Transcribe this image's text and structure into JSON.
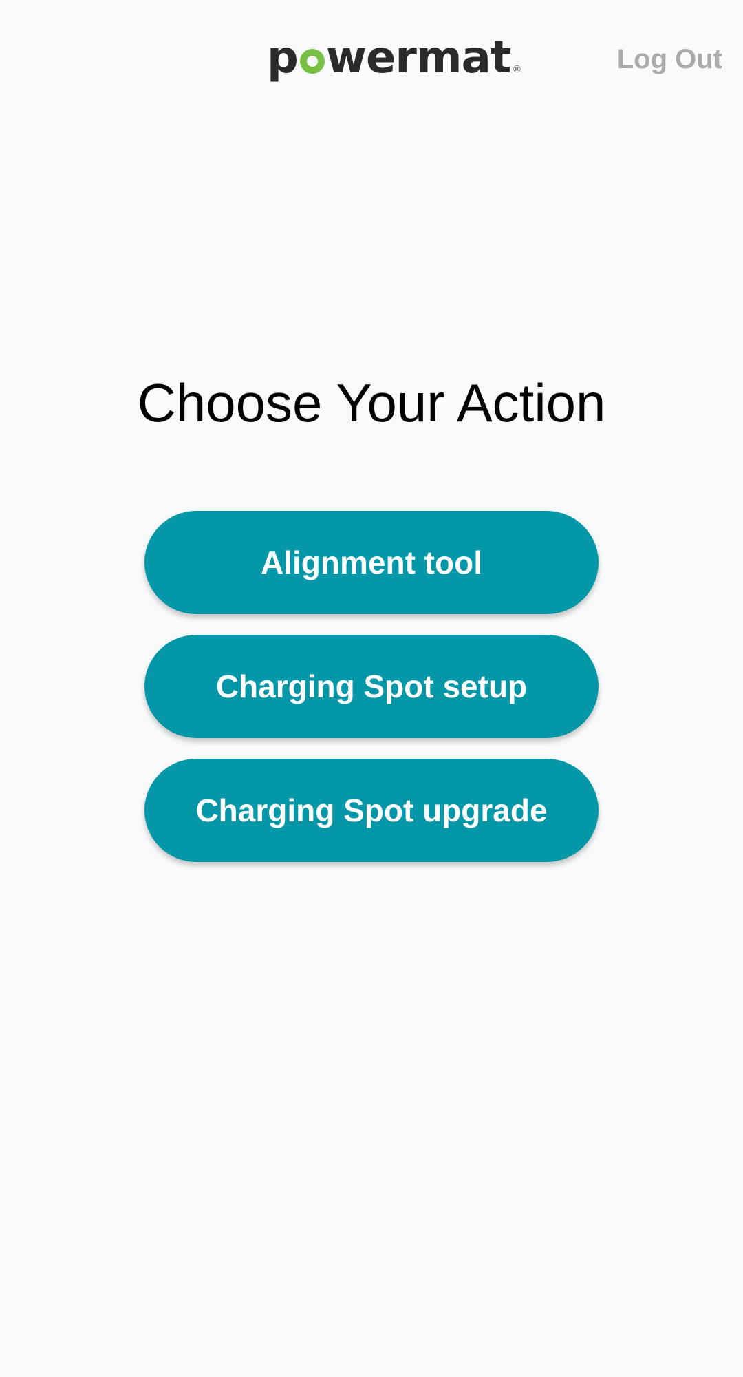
{
  "header": {
    "logo_prefix": "p",
    "logo_suffix": "wermat",
    "logo_reg": "®",
    "logout_label": "Log Out"
  },
  "main": {
    "title": "Choose Your Action",
    "actions": [
      {
        "label": "Alignment tool"
      },
      {
        "label": "Charging Spot setup"
      },
      {
        "label": "Charging Spot upgrade"
      }
    ]
  },
  "colors": {
    "accent": "#0497a7",
    "logo_green": "#78c043",
    "logout_gray": "#a9abad",
    "background": "#f9fafb"
  }
}
